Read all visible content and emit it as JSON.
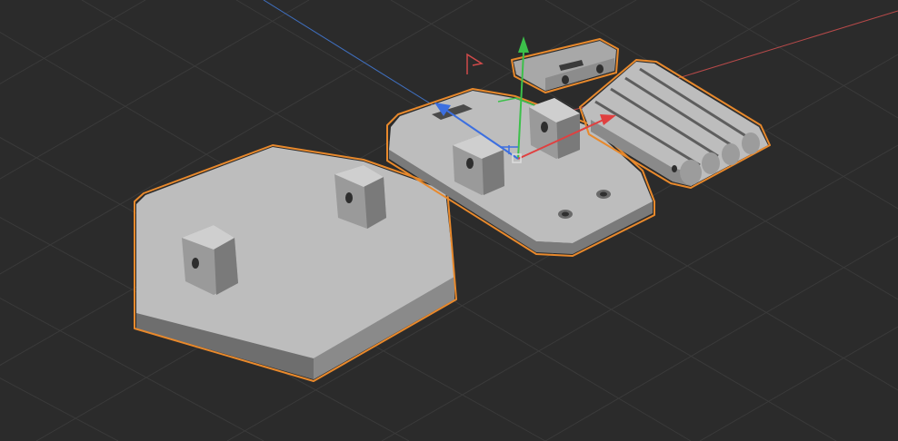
{
  "viewport": {
    "background": "#2b2b2b",
    "grid_color": "#3a3a3a",
    "x_axis_color": "#b84a4a",
    "z_axis_color": "#3f6fbf"
  },
  "selection": {
    "outline_color": "#e8892c",
    "objects": [
      "hexagonal-plate",
      "mounting-plate",
      "hinge-bracket",
      "slotted-arm"
    ]
  },
  "gizmo": {
    "x_color": "#e04040",
    "y_color": "#3cc04a",
    "z_color": "#3c6fe0",
    "center_color": "#dddddd"
  },
  "view_3d": {
    "x_axis_color": "#cc6666",
    "face_light": "#bdbdbd",
    "face_mid": "#a8a8a8",
    "face_dark": "#7f7f7f",
    "face_darker": "#6e6e6e"
  }
}
